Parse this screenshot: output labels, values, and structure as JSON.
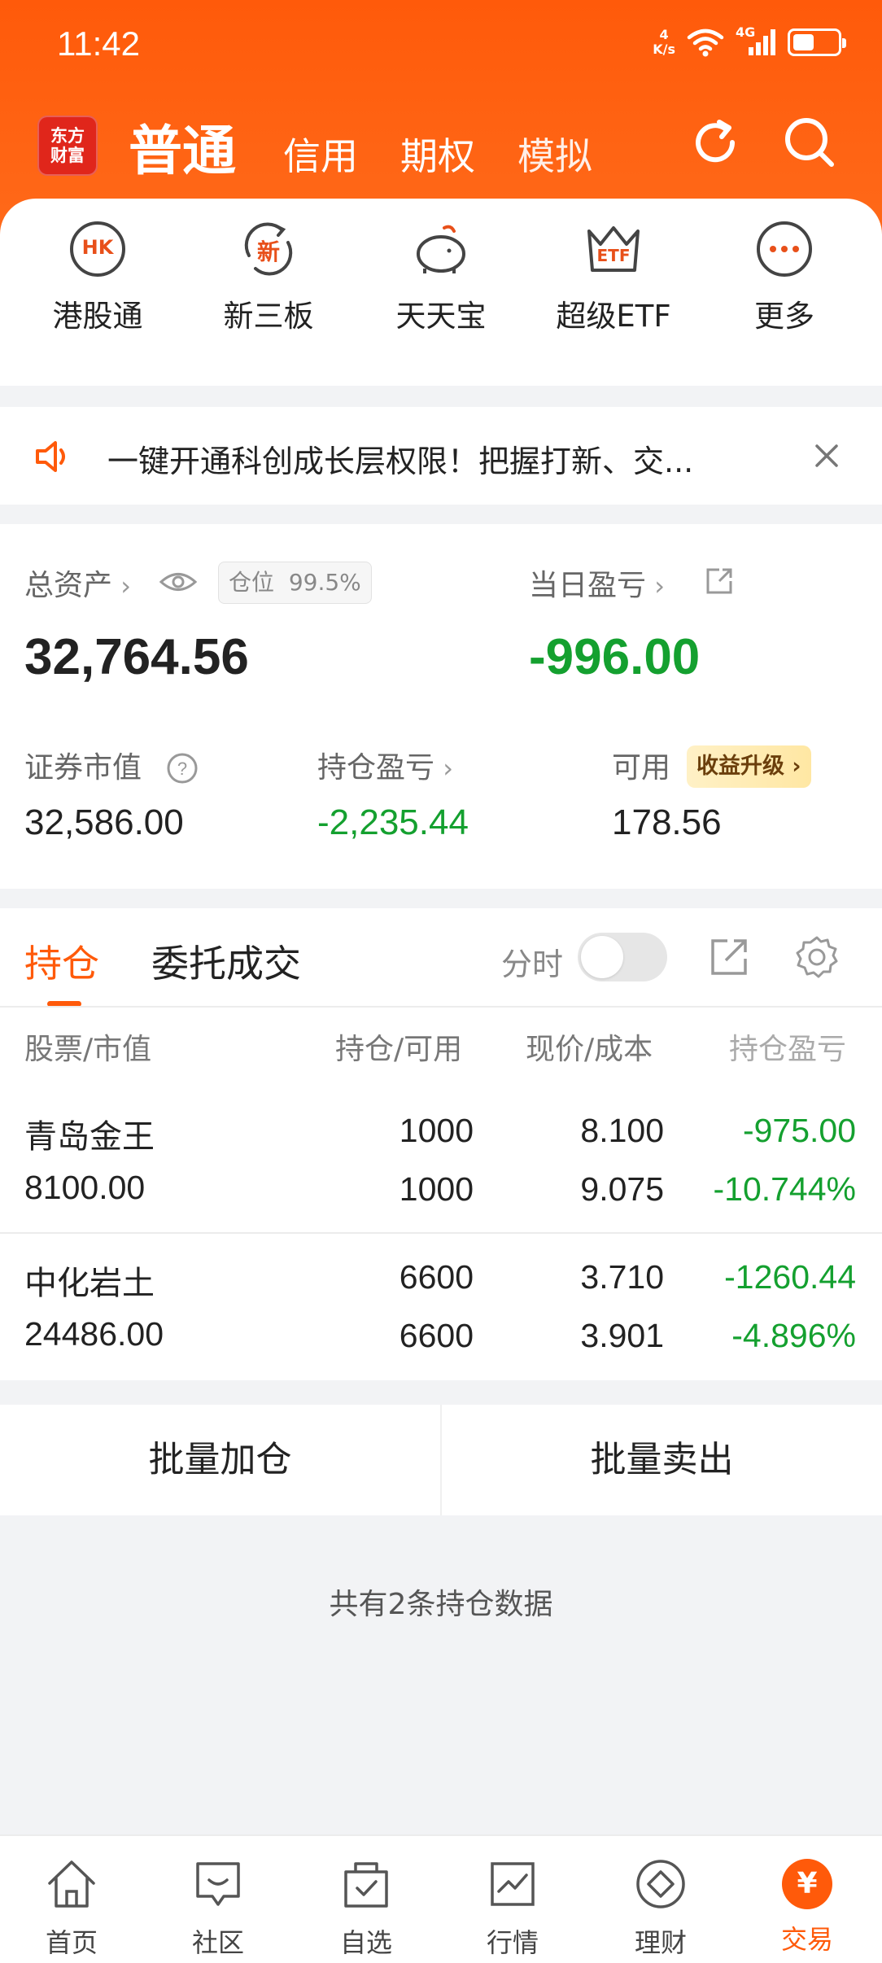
{
  "status_bar": {
    "time": "11:42",
    "speed_value": "4",
    "speed_unit": "K/s",
    "network": "4G"
  },
  "header": {
    "logo_line1": "东方",
    "logo_line2": "财富",
    "tabs": [
      "普通",
      "信用",
      "期权",
      "模拟"
    ],
    "active_tab": "普通"
  },
  "shortcuts": [
    {
      "label": "港股通",
      "icon": "hk-icon",
      "icon_text": "HK"
    },
    {
      "label": "新三板",
      "icon": "new-board-icon",
      "icon_text": "新"
    },
    {
      "label": "天天宝",
      "icon": "piggy-bank-icon"
    },
    {
      "label": "超级ETF",
      "icon": "etf-crown-icon",
      "icon_text": "ETF"
    },
    {
      "label": "更多",
      "icon": "more-icon"
    }
  ],
  "notice": {
    "text": "一键开通科创成长层权限！把握打新、交..."
  },
  "assets": {
    "total_label": "总资产",
    "position_label": "仓位",
    "position_value": "99.5%",
    "total_value": "32,764.56",
    "daily_pl_label": "当日盈亏",
    "daily_pl_value": "-996.00",
    "market_value_label": "证券市值",
    "market_value": "32,586.00",
    "holding_pl_label": "持仓盈亏",
    "holding_pl_value": "-2,235.44",
    "available_label": "可用",
    "upgrade_badge": "收益升级",
    "available_value": "178.56"
  },
  "positions": {
    "tabs": [
      "持仓",
      "委托成交"
    ],
    "timeshare_label": "分时",
    "timeshare_on": false,
    "columns": [
      "股票/市值",
      "持仓/可用",
      "现价/成本",
      "持仓盈亏"
    ],
    "rows": [
      {
        "name": "青岛金王",
        "market_value": "8100.00",
        "holding": "1000",
        "available": "1000",
        "price": "8.100",
        "cost": "9.075",
        "pl": "-975.00",
        "pl_pct": "-10.744%"
      },
      {
        "name": "中化岩土",
        "market_value": "24486.00",
        "holding": "6600",
        "available": "6600",
        "price": "3.710",
        "cost": "3.901",
        "pl": "-1260.44",
        "pl_pct": "-4.896%"
      }
    ]
  },
  "batch": {
    "add": "批量加仓",
    "sell": "批量卖出"
  },
  "footer_note": "共有2条持仓数据",
  "bottom_nav": [
    {
      "label": "首页",
      "icon": "home-icon"
    },
    {
      "label": "社区",
      "icon": "community-icon"
    },
    {
      "label": "自选",
      "icon": "watchlist-icon"
    },
    {
      "label": "行情",
      "icon": "market-icon"
    },
    {
      "label": "理财",
      "icon": "wealth-icon"
    },
    {
      "label": "交易",
      "icon": "trade-icon",
      "icon_text": "¥"
    }
  ],
  "colors": {
    "brand_orange": "#ff5a0a",
    "loss_green": "#14a02f"
  }
}
